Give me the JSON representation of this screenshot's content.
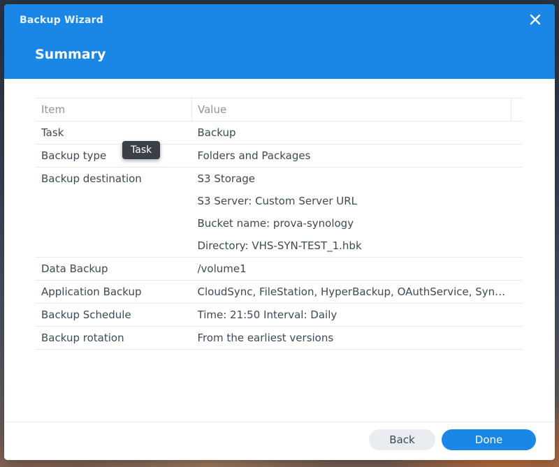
{
  "window": {
    "title": "Backup Wizard",
    "close_icon": "close-icon"
  },
  "step": {
    "title": "Summary"
  },
  "table": {
    "columns": [
      "Item",
      "Value"
    ],
    "rows": [
      {
        "item": "Task",
        "values": [
          "Backup"
        ]
      },
      {
        "item": "Backup type",
        "values": [
          "Folders and Packages"
        ]
      },
      {
        "item": "Backup destination",
        "values": [
          "S3 Storage",
          "S3 Server: Custom Server URL",
          "Bucket name: prova-synology",
          "Directory: VHS-SYN-TEST_1.hbk"
        ]
      },
      {
        "item": "Data Backup",
        "values": [
          "/volume1"
        ]
      },
      {
        "item": "Application Backup",
        "values": [
          "CloudSync, FileStation, HyperBackup, OAuthService, Syn…"
        ]
      },
      {
        "item": "Backup Schedule",
        "values": [
          "Time: 21:50 Interval: Daily"
        ]
      },
      {
        "item": "Backup rotation",
        "values": [
          "From the earliest versions"
        ]
      }
    ]
  },
  "tooltip": {
    "text": "Task"
  },
  "footer": {
    "back_label": "Back",
    "done_label": "Done"
  },
  "colors": {
    "accent": "#1a86e6",
    "header_text": "#ffffff",
    "secondary_button": "#e9edf1",
    "tooltip_bg": "#3b4047"
  }
}
